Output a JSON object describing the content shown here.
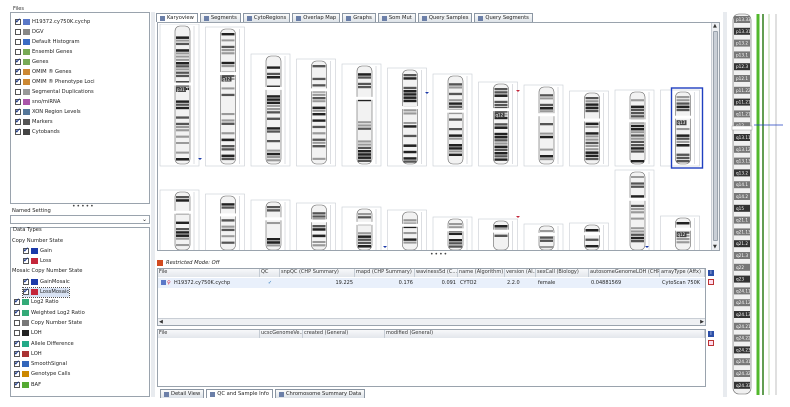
{
  "left_panel": {
    "files_title": "Files",
    "file_items": [
      {
        "label": "H19372.cy750K.cychp",
        "checked": true,
        "icon": "file-icon"
      },
      {
        "label": "DGV",
        "checked": false,
        "icon": "db-icon"
      },
      {
        "label": "Default Histogram",
        "checked": false,
        "icon": "histogram-icon"
      },
      {
        "label": "Ensembl Genes",
        "checked": false,
        "icon": "gene-icon"
      },
      {
        "label": "Genes",
        "checked": true,
        "icon": "gene-icon"
      },
      {
        "label": "OMIM ® Genes",
        "checked": true,
        "icon": "omim-icon"
      },
      {
        "label": "OMIM ® Phenotype Loci",
        "checked": true,
        "icon": "omim-icon"
      },
      {
        "label": "Segmental Duplications",
        "checked": false,
        "icon": "segdup-icon"
      },
      {
        "label": "sno/miRNA",
        "checked": true,
        "icon": "rna-icon"
      },
      {
        "label": "XON Region Levels",
        "checked": true,
        "icon": "xon-icon"
      },
      {
        "label": "Markers",
        "checked": true,
        "icon": "marker-icon"
      },
      {
        "label": "Cytobands",
        "checked": true,
        "icon": "cytoband-icon"
      }
    ],
    "named_setting_title": "Named Setting",
    "data_types_title": "Data Types",
    "data_types": [
      {
        "label": "Copy Number State",
        "kind": "header"
      },
      {
        "label": "Gain",
        "checked": true,
        "kind": "item",
        "icon": "up-arrow-icon"
      },
      {
        "label": "Loss",
        "checked": true,
        "kind": "item",
        "icon": "down-arrow-icon"
      },
      {
        "label": "Mosaic Copy Number State",
        "kind": "header"
      },
      {
        "label": "GainMosaic",
        "checked": true,
        "kind": "item",
        "icon": "up-arrow-icon"
      },
      {
        "label": "LossMosaic",
        "checked": true,
        "kind": "item",
        "icon": "down-arrow-icon",
        "selected": true
      },
      {
        "label": "Log2 Ratio",
        "checked": true,
        "kind": "item",
        "icon": "log-icon"
      },
      {
        "label": "Weighted Log2 Ratio",
        "checked": true,
        "kind": "item",
        "icon": "log-icon"
      },
      {
        "label": "Copy Number State",
        "checked": false,
        "kind": "item",
        "icon": "cn-icon"
      },
      {
        "label": "LOH",
        "checked": false,
        "kind": "item",
        "icon": "loh-x-icon"
      },
      {
        "label": "Allele Difference",
        "checked": true,
        "kind": "item",
        "icon": "allele-icon"
      },
      {
        "label": "LOH",
        "checked": true,
        "kind": "item",
        "icon": "loh-icon"
      },
      {
        "label": "SmoothSignal",
        "checked": true,
        "kind": "item",
        "icon": "signal-icon"
      },
      {
        "label": "Genotype Calls",
        "checked": true,
        "kind": "item",
        "icon": "genotype-icon"
      },
      {
        "label": "BAF",
        "checked": true,
        "kind": "item",
        "icon": "baf-icon"
      }
    ]
  },
  "top_tabs": [
    {
      "label": "Karyoview",
      "active": true
    },
    {
      "label": "Segments",
      "active": false
    },
    {
      "label": "CytoRegions",
      "active": false
    },
    {
      "label": "Overlap Map",
      "active": false
    },
    {
      "label": "Graphs",
      "active": false
    },
    {
      "label": "Som Mut",
      "active": false
    },
    {
      "label": "Query Samples",
      "active": false
    },
    {
      "label": "Query Segments",
      "active": false
    }
  ],
  "karyoview": {
    "row1_labels": [
      "p31.1",
      "q12",
      "",
      "",
      "",
      "",
      "",
      "q12",
      "",
      "",
      "",
      "q13"
    ],
    "row2_labels": [
      "",
      "",
      "",
      "",
      "",
      "",
      "",
      "",
      "",
      "",
      "",
      "q12"
    ]
  },
  "restricted_mode": "Restricted Mode: Off",
  "sample_table": {
    "headers": [
      "File",
      "QC",
      "snpQC (CHP Summary)",
      "mapd (CHP Summary)",
      "waviness5d (C...",
      "name (Algorithm)",
      "version (Al...",
      "sexCall (Biology)",
      "autosomeGenomeLOH (CHP ...",
      "arrayType (Affx)"
    ],
    "rows": [
      [
        "H19372.cy750K.cychp",
        "✓",
        "19.225",
        "0.176",
        "0.091",
        "CYTO2",
        "2.2.0",
        "female",
        "0.04881569",
        "CytoScan 750K"
      ]
    ]
  },
  "file_table": {
    "headers": [
      "File",
      "ucscGenomeVe...",
      "created (General)",
      "modified (General)"
    ]
  },
  "bottom_tabs": [
    {
      "label": "Detail View",
      "active": false
    },
    {
      "label": "QC and Sample Info",
      "active": true
    },
    {
      "label": "Chromosome Summary Data",
      "active": false
    }
  ],
  "right_panel": {
    "bands": [
      "p13.33",
      "p13.31",
      "p13.2",
      "p13.1",
      "p12.3",
      "p12.1",
      "p11.22",
      "p11.21",
      "q11.21",
      "q12",
      "q13.11",
      "q13.12",
      "q13.13",
      "q13.2",
      "q14.1",
      "q14.2",
      "q15",
      "q21.1",
      "q21.13",
      "q21.2",
      "q21.3",
      "q22",
      "q23",
      "q24.11",
      "q24.12",
      "q24.13",
      "q24.21",
      "q24.22",
      "q24.23",
      "q24.31",
      "q24.32",
      "q24.33"
    ]
  },
  "colors": {
    "accent": "#1f3fc0",
    "gain": "#1c3aa9",
    "loss": "#c4263a",
    "green": "#52b82c",
    "dark_green": "#2f7f18"
  }
}
